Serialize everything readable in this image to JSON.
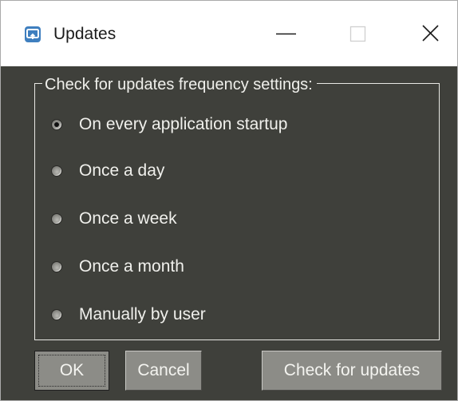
{
  "window": {
    "title": "Updates"
  },
  "titlebar_buttons": {
    "minimize": "minimize-icon",
    "maximize": "maximize-icon",
    "close": "close-icon"
  },
  "group": {
    "title": "Check for updates frequency settings:",
    "selected_index": 0,
    "options": [
      "On every application startup",
      "Once a day",
      "Once a week",
      "Once a month",
      "Manually by user"
    ]
  },
  "buttons": {
    "ok": "OK",
    "cancel": "Cancel",
    "check": "Check for updates"
  },
  "colors": {
    "dialog_background": "#3f403b",
    "button_face": "#8c8c87",
    "text": "#f0f0ec",
    "title_icon": "#3f7fbf"
  }
}
